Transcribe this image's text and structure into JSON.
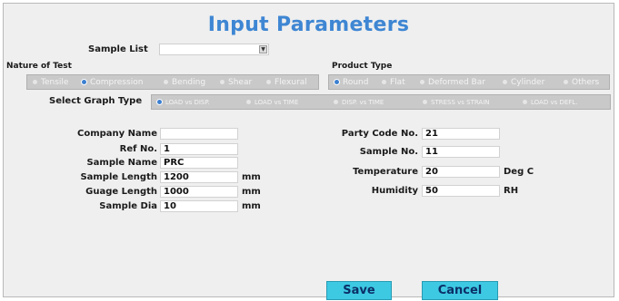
{
  "title": "Input Parameters",
  "sample_list": {
    "label": "Sample List",
    "value": ""
  },
  "nature_of_test": {
    "header": "Nature of Test",
    "options": [
      "Tensile",
      "Compression",
      "Bending",
      "Shear",
      "Flexural"
    ],
    "selected": "Compression"
  },
  "product_type": {
    "header": "Product Type",
    "options": [
      "Round",
      "Flat",
      "Deformed Bar",
      "Cylinder",
      "Others"
    ],
    "selected": "Round"
  },
  "graph_type": {
    "label": "Select Graph Type",
    "options": [
      "LOAD vs DISP.",
      "LOAD vs TIME",
      "DISP. vs TIME",
      "STRESS vs STRAIN",
      "LOAD vs DEFL."
    ],
    "selected": "LOAD vs DISP."
  },
  "left_fields": [
    {
      "label": "Company Name",
      "value": "",
      "unit": ""
    },
    {
      "label": "Ref No.",
      "value": "1",
      "unit": ""
    },
    {
      "label": "Sample Name",
      "value": "PRC",
      "unit": ""
    },
    {
      "label": "Sample Length",
      "value": "1200",
      "unit": "mm"
    },
    {
      "label": "Guage Length",
      "value": "1000",
      "unit": "mm"
    },
    {
      "label": "Sample Dia",
      "value": "10",
      "unit": "mm"
    }
  ],
  "right_fields": [
    {
      "label": "Party Code No.",
      "value": "21",
      "unit": ""
    },
    {
      "label": "Sample No.",
      "value": "11",
      "unit": ""
    },
    {
      "label": "Temperature",
      "value": "20",
      "unit": "Deg C"
    },
    {
      "label": "Humidity",
      "value": "50",
      "unit": "RH"
    }
  ],
  "buttons": {
    "save": "Save",
    "cancel": "Cancel"
  },
  "colors": {
    "title": "#3e86d3",
    "button": "#3ec9e3",
    "button_text": "#0b2f67",
    "radio_selected": "#3c7fd0"
  }
}
